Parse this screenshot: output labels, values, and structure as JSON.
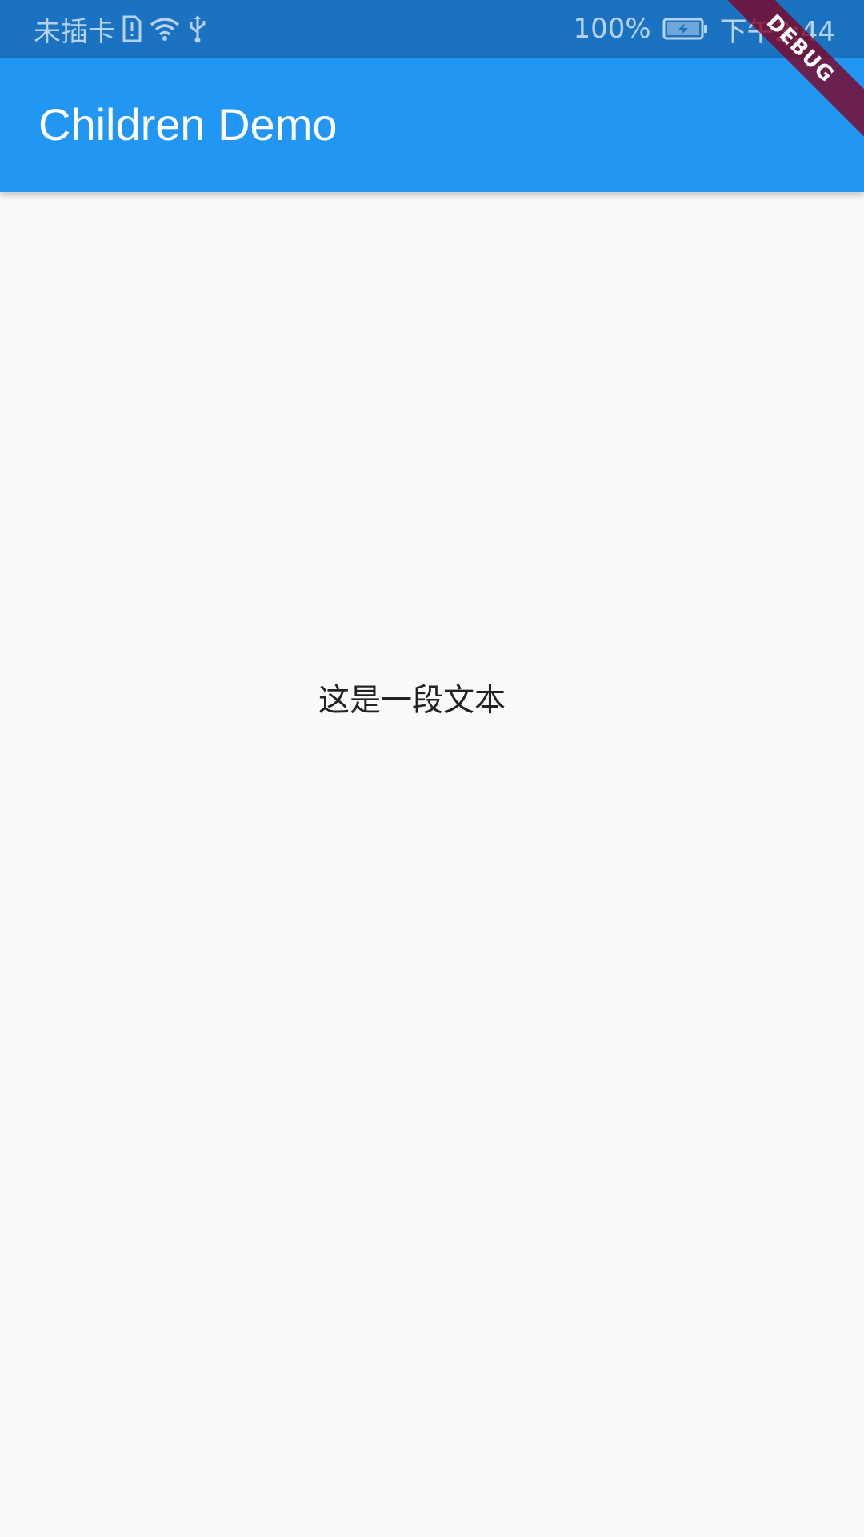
{
  "status_bar": {
    "carrier": "未插卡",
    "battery_percent": "100%",
    "time": "下午3:44",
    "icons": [
      "sim-alert-icon",
      "wifi-icon",
      "usb-icon",
      "battery-charging-icon"
    ]
  },
  "app_bar": {
    "title": "Children Demo"
  },
  "body": {
    "text": "这是一段文本"
  },
  "debug_banner": {
    "label": "DEBUG"
  },
  "colors": {
    "status_bar": "#1a72c0",
    "app_bar": "#2196f3",
    "background": "#fafafa",
    "debug_ribbon": "#800020"
  }
}
